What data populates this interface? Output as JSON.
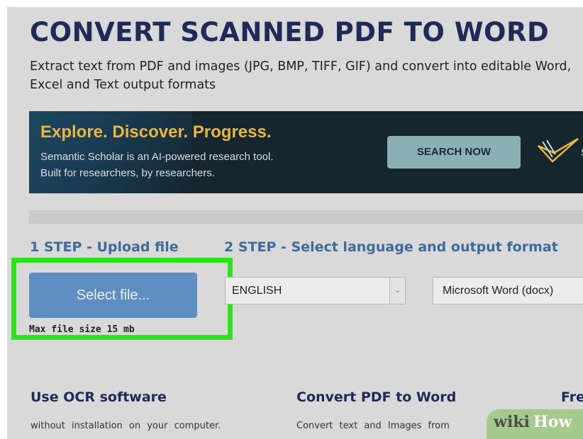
{
  "page": {
    "title": "CONVERT SCANNED PDF TO WORD",
    "subtitle": "Extract text from PDF and images (JPG, BMP, TIFF, GIF) and convert into editable Word, Excel and Text output formats"
  },
  "ad": {
    "headline": "Explore. Discover. Progress.",
    "line1": "Semantic Scholar is an AI-powered research tool.",
    "line2": "Built for researchers, by researchers.",
    "button_label": "SEARCH NOW",
    "logo_icon": "semantic-scholar-logo-icon",
    "logo_letter": "S",
    "colors": {
      "headline": "#e9b73c",
      "background": "#15262f",
      "button": "#8ab0b5"
    }
  },
  "steps": {
    "step1_label": "1 STEP - Upload file",
    "step2_label": "2 STEP - Select language and output format",
    "select_file_label": "Select file...",
    "max_size_note": "Max file size 15 mb",
    "language": {
      "selected": "ENGLISH",
      "arrow_icon": "chevron-down-icon"
    },
    "output_format": {
      "selected": "Microsoft Word (docx)"
    }
  },
  "features": [
    {
      "heading": "Use OCR software",
      "text": "without installation on your computer."
    },
    {
      "heading": "Convert PDF to Word",
      "text": "Convert text and Images from"
    },
    {
      "heading": "Fre",
      "text": ""
    }
  ],
  "watermark": {
    "wiki": "wiki",
    "how": "How"
  },
  "colors": {
    "highlight_border": "#2ee21f",
    "step_label": "#3f6a9a",
    "title": "#1f2a57",
    "primary_button": "#5e8ec2"
  }
}
